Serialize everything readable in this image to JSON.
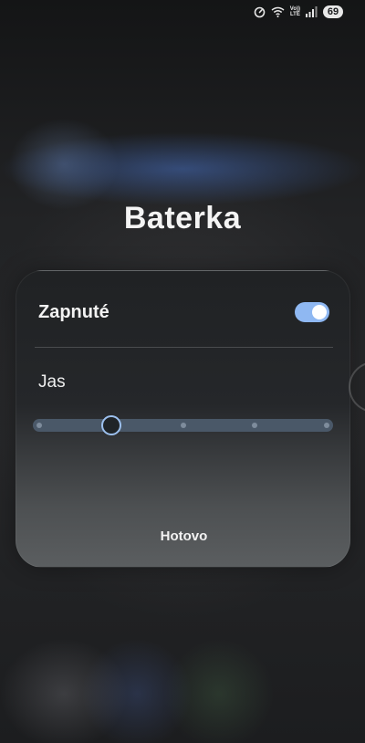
{
  "status_bar": {
    "volte_label": "Vo))",
    "lte_label": "LTE",
    "battery_level": "69",
    "icons": [
      "data-saver-icon",
      "wifi-icon",
      "volte-icon",
      "signal-icon",
      "battery-icon"
    ]
  },
  "dialog": {
    "title": "Baterka",
    "toggle": {
      "label": "Zapnuté",
      "on": true
    },
    "brightness": {
      "label": "Jas",
      "steps": 5,
      "selected_step": 2
    },
    "done_label": "Hotovo"
  },
  "colors": {
    "accent": "#8fb8f2",
    "slider_track": "#4a5868",
    "text": "#f2f2f2"
  }
}
